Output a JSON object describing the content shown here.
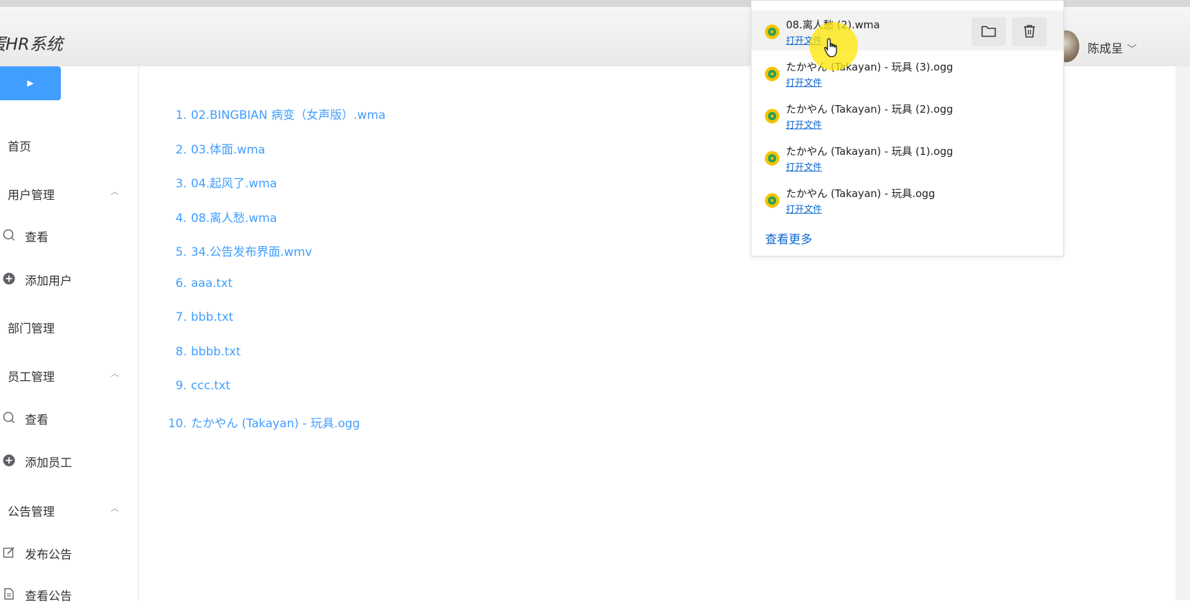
{
  "header": {
    "app_title": "蛋HR系统",
    "user_name": "陈成呈",
    "user_chevron": "﹀"
  },
  "sidebar": {
    "collapse_glyph": "▶",
    "items": [
      {
        "label": "首页",
        "type": "item"
      },
      {
        "label": "用户管理",
        "type": "group",
        "caret": "︿"
      },
      {
        "label": "查看",
        "type": "sub",
        "icon": "search-icon"
      },
      {
        "label": "添加用户",
        "type": "sub",
        "icon": "plus-circle-icon"
      },
      {
        "label": "部门管理",
        "type": "item"
      },
      {
        "label": "员工管理",
        "type": "group",
        "caret": "︿"
      },
      {
        "label": "查看",
        "type": "sub",
        "icon": "search-icon"
      },
      {
        "label": "添加员工",
        "type": "sub",
        "icon": "plus-circle-icon"
      },
      {
        "label": "公告管理",
        "type": "group",
        "caret": "︿"
      },
      {
        "label": "发布公告",
        "type": "sub",
        "icon": "edit-icon"
      },
      {
        "label": "查看公告",
        "type": "sub",
        "icon": "document-icon"
      }
    ]
  },
  "file_list": [
    {
      "num": "1.",
      "name": "02.BINGBIAN 病变（女声版）.wma"
    },
    {
      "num": "2.",
      "name": "03.体面.wma"
    },
    {
      "num": "3.",
      "name": "04.起风了.wma"
    },
    {
      "num": "4.",
      "name": "08.离人愁.wma"
    },
    {
      "num": "5.",
      "name": "34.公告发布界面.wmv"
    },
    {
      "num": "6.",
      "name": "aaa.txt"
    },
    {
      "num": "7.",
      "name": "bbb.txt"
    },
    {
      "num": "8.",
      "name": "bbbb.txt"
    },
    {
      "num": "9.",
      "name": "ccc.txt"
    },
    {
      "num": "10.",
      "name": "たかやん (Takayan) - 玩具.ogg"
    }
  ],
  "downloads": {
    "items": [
      {
        "name": "08.离人愁 (2).wma",
        "open_label": "打开文件"
      },
      {
        "name": "たかやん (Takayan) - 玩具 (3).ogg",
        "open_label": "打开文件"
      },
      {
        "name": "たかやん (Takayan) - 玩具 (2).ogg",
        "open_label": "打开文件"
      },
      {
        "name": "たかやん (Takayan) - 玩具 (1).ogg",
        "open_label": "打开文件"
      },
      {
        "name": "たかやん (Takayan) - 玩具.ogg",
        "open_label": "打开文件"
      }
    ],
    "see_more": "查看更多"
  },
  "colors": {
    "accent": "#409eff",
    "link_blue": "#0b64d0",
    "cursor_highlight": "#ffe600"
  }
}
